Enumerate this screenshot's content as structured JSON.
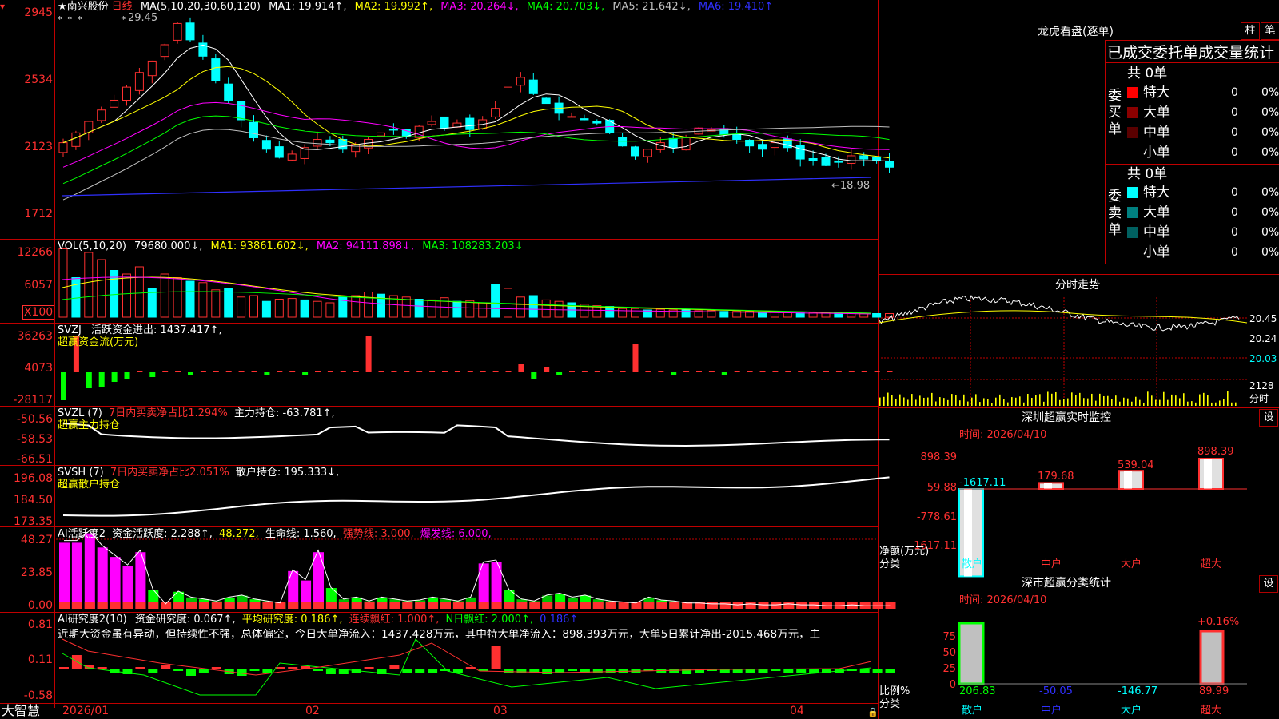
{
  "stock": {
    "name": "★南兴股份",
    "period": "日线",
    "ma_label": "MA(5,10,20,30,60,120)",
    "ma1": "MA1: 19.914↑,",
    "ma2": "MA2: 19.992↑,",
    "ma3": "MA3: 20.264↓,",
    "ma4": "MA4: 20.703↓,",
    "ma5": "MA5: 21.642↓,",
    "ma6": "MA6: 19.410↑",
    "high_mark": "29.45",
    "low_mark": "←18.98",
    "axis": [
      "2945",
      "2534",
      "2123",
      "1712"
    ]
  },
  "volume": {
    "label": "VOL(5,10,20)",
    "value": "79680.000↓,",
    "ma1": "MA1: 93861.602↓,",
    "ma2": "MA2: 94111.898↓,",
    "ma3": "MA3: 108283.203↓",
    "axis": [
      "12266",
      "6057",
      "X100"
    ]
  },
  "svzj": {
    "label": "SVZJ",
    "field": "活跃资金进出: 1437.417↑,",
    "subtitle": "超赢资金流(万元)",
    "axis": [
      "36263",
      "4073",
      "-28117"
    ]
  },
  "svzl": {
    "label": "SVZL (7)",
    "field1": "7日内买卖净占比1.294%",
    "field2": "主力持仓: -63.781↑,",
    "subtitle": "超赢主力持仓",
    "axis": [
      "-50.56",
      "-58.53",
      "-66.51"
    ]
  },
  "svsh": {
    "label": "SVSH (7)",
    "field1": "7日内买卖净占比2.051%",
    "field2": "散户持仓: 195.333↓,",
    "subtitle": "超赢散户持仓",
    "axis": [
      "196.08",
      "184.50",
      "173.35"
    ]
  },
  "active": {
    "label": "AI活跃度2",
    "field1": "资金活跃度: 2.288↑,",
    "field2": "48.272,",
    "field3": "生命线: 1.560,",
    "field4": "强势线: 3.000,",
    "field5": "爆发线: 6.000,",
    "axis": [
      "48.27",
      "23.85",
      "0.00"
    ]
  },
  "research": {
    "label": "AI研究度2(10)",
    "field1": "资金研究度: 0.067↑,",
    "field2": "平均研究度: 0.186↑,",
    "field3": "连续飘红: 1.000↑,",
    "field4": "N日飘红: 2.000↑,",
    "field5": "0.186↑",
    "comment": "近期大资金虽有异动，但持续性不强，总体偏空，今日大单净流入：1437.428万元，其中特大单净流入：898.393万元，大单5日累计净出-2015.468万元，主",
    "axis": [
      "0.81",
      "0.11",
      "-0.58"
    ]
  },
  "bottom": {
    "brand": "大智慧",
    "dates": [
      "2026/01",
      "02",
      "03",
      "04"
    ]
  },
  "longhu": {
    "title": "龙虎看盘(逐单)",
    "btn_zhu": "柱",
    "btn_bi": "笔",
    "heading": "已成交委托单成交量统计",
    "buy_label": "委买单",
    "sell_label": "委卖单",
    "buy_total": "共 0单",
    "sell_total": "共 0单",
    "rows": [
      {
        "name": "特大",
        "count": "0",
        "pct": "0%"
      },
      {
        "name": "大单",
        "count": "0",
        "pct": "0%"
      },
      {
        "name": "中单",
        "count": "0",
        "pct": "0%"
      },
      {
        "name": "小单",
        "count": "0",
        "pct": "0%"
      }
    ],
    "buy_colors": [
      "#ff0000",
      "#8b0000",
      "#5a0000",
      "#000000"
    ],
    "sell_colors": [
      "#00ffff",
      "#008080",
      "#006060",
      "#000000"
    ]
  },
  "intraday": {
    "title": "分时走势",
    "axis": [
      "20.45",
      "20.24",
      "20.03",
      "2128"
    ],
    "vol_label": "分时"
  },
  "sz_monitor": {
    "title": "深圳超赢实时监控",
    "btn": "设",
    "time": "时间: 2026/04/10",
    "axis": [
      "898.39",
      "59.88",
      "-778.61",
      "-1617.11"
    ],
    "values": [
      "-1617.11",
      "179.68",
      "539.04",
      "898.39"
    ],
    "bar_values": [
      -1617.11,
      179.68,
      539.04,
      898.39
    ],
    "ylabel": "净额(万元)",
    "xlabel": "分类",
    "categories": [
      "散户",
      "中户",
      "大户",
      "超大"
    ]
  },
  "sz_class": {
    "title": "深市超赢分类统计",
    "btn": "设",
    "time": "时间: 2026/04/10",
    "axis": [
      "75",
      "50",
      "25",
      "0"
    ],
    "top_value": "+0.16%",
    "values": [
      "206.83",
      "-50.05",
      "-146.77",
      "89.99"
    ],
    "ylabel": "比例%",
    "xlabel": "分类",
    "categories": [
      "散户",
      "中户",
      "大户",
      "超大"
    ]
  }
}
